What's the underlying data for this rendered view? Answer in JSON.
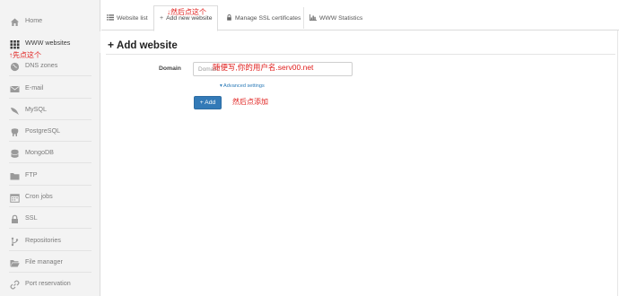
{
  "sidebar": {
    "items": [
      {
        "label": "Home",
        "icon": "home-icon"
      },
      {
        "label": "WWW websites",
        "icon": "grid-icon"
      },
      {
        "label": "DNS zones",
        "icon": "globe-icon"
      },
      {
        "label": "E-mail",
        "icon": "envelope-icon"
      },
      {
        "label": "MySQL",
        "icon": "dolphin-icon"
      },
      {
        "label": "PostgreSQL",
        "icon": "elephant-icon"
      },
      {
        "label": "MongoDB",
        "icon": "database-icon"
      },
      {
        "label": "FTP",
        "icon": "folder-icon"
      },
      {
        "label": "Cron jobs",
        "icon": "calendar-icon"
      },
      {
        "label": "SSL",
        "icon": "lock-icon"
      },
      {
        "label": "Repositories",
        "icon": "branch-icon"
      },
      {
        "label": "File manager",
        "icon": "folder-open-icon"
      },
      {
        "label": "Port reservation",
        "icon": "link-icon"
      }
    ]
  },
  "tabs": [
    {
      "label": "Website list",
      "icon": "list-icon"
    },
    {
      "label": "Add new website",
      "icon": "plus-icon"
    },
    {
      "label": "Manage SSL certificates",
      "icon": "lock-icon"
    },
    {
      "label": "WWW Statistics",
      "icon": "bar-chart-icon"
    }
  ],
  "main": {
    "title": "Add website",
    "domain_label": "Domain",
    "domain_placeholder": "Domain",
    "advanced_link": "▾ Advanced settings",
    "add_button": "+ Add"
  },
  "annotations": {
    "sidebar_note": "↑先点这个",
    "tab_note": "↓然后点这个",
    "domain_note": "随便写,你的用户名.serv00.net",
    "button_note": "然后点添加"
  },
  "colors": {
    "accent": "#337ab7",
    "annotation": "#e0201e",
    "sidebar_bg": "#f3f3f3"
  }
}
